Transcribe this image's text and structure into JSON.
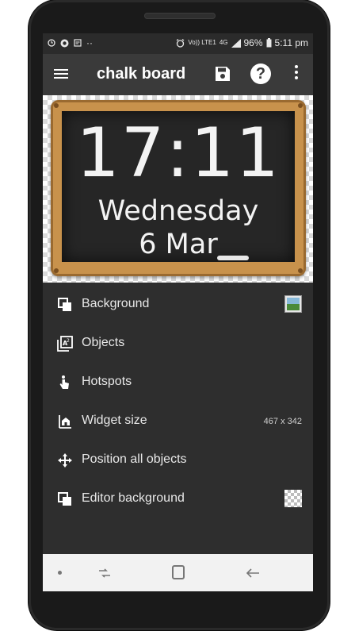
{
  "status_bar": {
    "time": "5:11 pm",
    "battery": "96%",
    "network_label": "4G",
    "volte_label": "Vo)) LTE1",
    "dots": "··",
    "icons": [
      "alarm-icon",
      "whatsapp-icon",
      "notes-icon",
      "alarm-clock-icon",
      "signal-icon",
      "battery-icon"
    ]
  },
  "app_bar": {
    "title": "chalk board",
    "help_label": "?",
    "icons": [
      "menu-icon",
      "save-icon",
      "help-icon",
      "more-vert-icon"
    ]
  },
  "widget_preview": {
    "time": "17:11",
    "day": "Wednesday",
    "date": "6 Mar"
  },
  "menu": {
    "items": [
      {
        "label": "Background",
        "icon": "background-icon",
        "trailing": "image-thumbnail"
      },
      {
        "label": "Objects",
        "icon": "objects-icon",
        "trailing": ""
      },
      {
        "label": "Hotspots",
        "icon": "hotspot-icon",
        "trailing": ""
      },
      {
        "label": "Widget size",
        "icon": "widget-size-icon",
        "value": "467 x 342"
      },
      {
        "label": "Position all objects",
        "icon": "move-icon",
        "trailing": ""
      },
      {
        "label": "Editor background",
        "icon": "editor-background-icon",
        "trailing": "checker-thumbnail"
      }
    ]
  },
  "nav_bar": {
    "icons": [
      "nav-dot-icon",
      "recents-icon",
      "home-icon",
      "back-icon"
    ]
  },
  "colors": {
    "app_bar": "#3a3a3a",
    "list_background": "#2e2e2e",
    "frame": "#c8924c",
    "board": "#262626",
    "nav_bar": "#f2f2f2"
  }
}
